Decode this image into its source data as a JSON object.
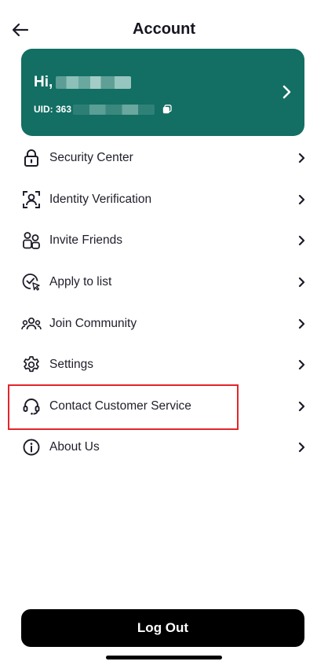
{
  "header": {
    "title": "Account"
  },
  "profile": {
    "greeting": "Hi,",
    "uid_prefix": "UID: 363"
  },
  "menu": {
    "items": [
      {
        "label": "Security Center",
        "icon": "lock-icon"
      },
      {
        "label": "Identity Verification",
        "icon": "face-scan-icon"
      },
      {
        "label": "Invite Friends",
        "icon": "invite-users-icon"
      },
      {
        "label": "Apply to list",
        "icon": "check-cursor-icon"
      },
      {
        "label": "Join Community",
        "icon": "community-icon"
      },
      {
        "label": "Settings",
        "icon": "gear-icon"
      },
      {
        "label": "Contact Customer Service",
        "icon": "headset-icon"
      },
      {
        "label": "About Us",
        "icon": "info-icon"
      }
    ]
  },
  "footer": {
    "logout_label": "Log Out"
  },
  "colors": {
    "card": "#136e63",
    "highlight": "#e3252a",
    "button": "#000000"
  }
}
